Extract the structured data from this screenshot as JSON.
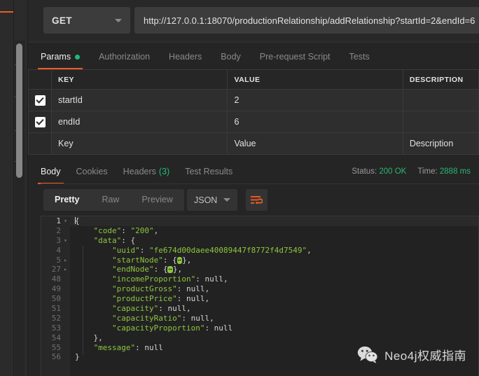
{
  "request": {
    "method": "GET",
    "method_caret_icon": "chevron-down-icon",
    "url": "http://127.0.0.1:18070/productionRelationship/addRelationship?startId=2&endId=6",
    "send_label": ""
  },
  "request_tabs": [
    {
      "label": "Params",
      "active": true,
      "dot": true
    },
    {
      "label": "Authorization",
      "active": false,
      "dot": false
    },
    {
      "label": "Headers",
      "active": false,
      "dot": false
    },
    {
      "label": "Body",
      "active": false,
      "dot": false
    },
    {
      "label": "Pre-request Script",
      "active": false,
      "dot": false
    },
    {
      "label": "Tests",
      "active": false,
      "dot": false
    }
  ],
  "params_table": {
    "headers": [
      "",
      "KEY",
      "VALUE",
      "DESCRIPTION"
    ],
    "rows": [
      {
        "checked": true,
        "key": "startId",
        "value": "2",
        "description": ""
      },
      {
        "checked": true,
        "key": "endId",
        "value": "6",
        "description": ""
      }
    ],
    "placeholder_row": {
      "key": "Key",
      "value": "Value",
      "description": "Description"
    }
  },
  "response_tabs": [
    {
      "label": "Body",
      "active": true,
      "count": ""
    },
    {
      "label": "Cookies",
      "active": false,
      "count": ""
    },
    {
      "label": "Headers",
      "active": false,
      "count": "(3)"
    },
    {
      "label": "Test Results",
      "active": false,
      "count": ""
    }
  ],
  "response_meta": {
    "status_label": "Status:",
    "status_value": "200 OK",
    "time_label": "Time:",
    "time_value": "2888 ms"
  },
  "format_toolbar": {
    "modes": [
      {
        "label": "Pretty",
        "active": true
      },
      {
        "label": "Raw",
        "active": false
      },
      {
        "label": "Preview",
        "active": false
      }
    ],
    "language": "JSON",
    "language_caret_icon": "chevron-down-icon",
    "wrap_icon": "word-wrap-icon"
  },
  "code": {
    "lines": [
      {
        "no": "1",
        "fold": "down",
        "current": true,
        "text": "{",
        "cursor": true
      },
      {
        "no": "2",
        "fold": "",
        "current": false,
        "text": "    \"code\": \"200\","
      },
      {
        "no": "3",
        "fold": "down",
        "current": false,
        "text": "    \"data\": {"
      },
      {
        "no": "4",
        "fold": "",
        "current": false,
        "text": "        \"uuid\": \"fe674d00daee40089447f8772f4d7549\","
      },
      {
        "no": "5",
        "fold": "right",
        "current": false,
        "text": "        \"startNode\": {",
        "badge": true,
        "tail": "},"
      },
      {
        "no": "27",
        "fold": "right",
        "current": false,
        "text": "        \"endNode\": {",
        "badge": true,
        "tail": "},"
      },
      {
        "no": "48",
        "fold": "",
        "current": false,
        "text": "        \"incomeProportion\": null,"
      },
      {
        "no": "49",
        "fold": "",
        "current": false,
        "text": "        \"productGross\": null,"
      },
      {
        "no": "50",
        "fold": "",
        "current": false,
        "text": "        \"productPrice\": null,"
      },
      {
        "no": "51",
        "fold": "",
        "current": false,
        "text": "        \"capacity\": null,"
      },
      {
        "no": "52",
        "fold": "",
        "current": false,
        "text": "        \"capacityRatio\": null,"
      },
      {
        "no": "53",
        "fold": "",
        "current": false,
        "text": "        \"capacityProportion\": null"
      },
      {
        "no": "54",
        "fold": "",
        "current": false,
        "text": "    },"
      },
      {
        "no": "55",
        "fold": "",
        "current": false,
        "text": "    \"message\": null"
      },
      {
        "no": "56",
        "fold": "",
        "current": false,
        "text": "}"
      }
    ]
  },
  "watermark": {
    "icon": "wechat-icon",
    "text": "Neo4j权威指南"
  },
  "colors": {
    "accent": "#ef5b25",
    "send": "#0f80ed",
    "success": "#2bb673",
    "json_key": "#8dc63f"
  }
}
